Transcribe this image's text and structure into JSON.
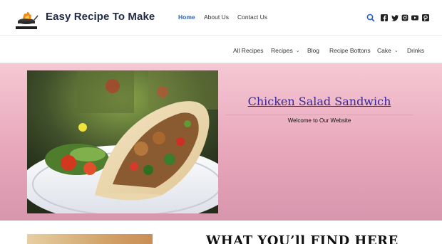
{
  "header": {
    "title": "Easy Recipe To Make",
    "nav": [
      {
        "label": "Home"
      },
      {
        "label": "About Us"
      },
      {
        "label": "Contact Us"
      }
    ],
    "icons": [
      "search-icon",
      "facebook-icon",
      "twitter-icon",
      "instagram-icon",
      "youtube-icon",
      "pinterest-icon"
    ],
    "accent": "#2a63c7"
  },
  "nav2": {
    "items": [
      {
        "label": "All Recipes"
      },
      {
        "label": "Recipes"
      },
      {
        "label": "Blog"
      },
      {
        "label": "Recipe Bottons"
      },
      {
        "label": "Cake"
      },
      {
        "label": "Drinks"
      }
    ]
  },
  "hero": {
    "title": "Chicken Salad Sandwich",
    "subtitle": "Welcome to Our Website",
    "title_color": "#35279a",
    "background": "#e8a7bb"
  },
  "below": {
    "heading": "WHAT YOU’ll FIND HERE"
  }
}
